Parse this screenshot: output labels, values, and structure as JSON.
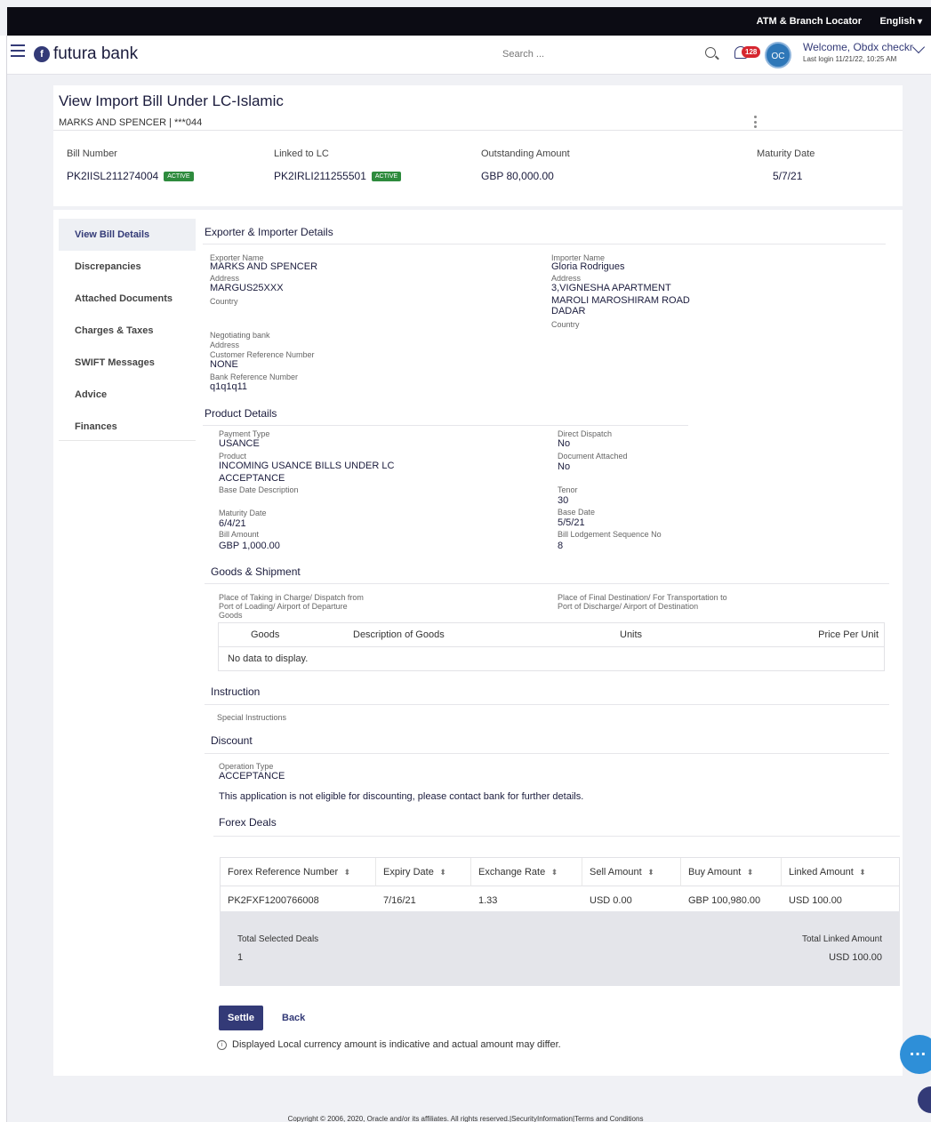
{
  "topbar": {
    "atm_locator": "ATM & Branch Locator",
    "language": "English"
  },
  "header": {
    "brand": "futura bank",
    "search_placeholder": "Search ...",
    "notifications_count": "128",
    "avatar_initials": "OC",
    "welcome": "Welcome, Obdx checkr",
    "last_login": "Last login 11/21/22, 10:25 AM"
  },
  "page": {
    "title": "View Import Bill Under LC-Islamic",
    "subtitle": "MARKS AND SPENCER | ***044"
  },
  "summary": {
    "bill_number_label": "Bill Number",
    "bill_number": "PK2IISL211274004",
    "bill_status": "ACTIVE",
    "linked_lc_label": "Linked to LC",
    "linked_lc": "PK2IRLI211255501",
    "lc_status": "ACTIVE",
    "outstanding_label": "Outstanding Amount",
    "outstanding": "GBP 80,000.00",
    "maturity_label": "Maturity Date",
    "maturity": "5/7/21"
  },
  "nav": [
    "View Bill Details",
    "Discrepancies",
    "Attached Documents",
    "Charges & Taxes",
    "SWIFT Messages",
    "Advice",
    "Finances"
  ],
  "exporter_importer": {
    "title": "Exporter & Importer Details",
    "exporter_name_label": "Exporter Name",
    "exporter_name": "MARKS AND SPENCER",
    "address_label": "Address",
    "exporter_address": "MARGUS25XXX",
    "country_label": "Country",
    "importer_name_label": "Importer Name",
    "importer_name": "Gloria Rodrigues",
    "importer_address_1": "3,VIGNESHA APARTMENT",
    "importer_address_2": "MAROLI MAROSHIRAM ROAD",
    "importer_address_3": "DADAR",
    "negotiating_bank_label": "Negotiating bank",
    "customer_ref_label": "Customer Reference Number",
    "customer_ref": "NONE",
    "bank_ref_label": "Bank Reference Number",
    "bank_ref": "q1q1q11"
  },
  "product": {
    "title": "Product Details",
    "payment_type_label": "Payment Type",
    "payment_type": "USANCE",
    "product_label": "Product",
    "product_1": "INCOMING USANCE BILLS UNDER LC",
    "product_2": "ACCEPTANCE",
    "base_date_desc_label": "Base Date Description",
    "maturity_label": "Maturity Date",
    "maturity": "6/4/21",
    "bill_amount_label": "Bill Amount",
    "bill_amount": "GBP 1,000.00",
    "direct_dispatch_label": "Direct Dispatch",
    "direct_dispatch": "No",
    "doc_attached_label": "Document Attached",
    "doc_attached": "No",
    "tenor_label": "Tenor",
    "tenor": "30",
    "base_date_label": "Base Date",
    "base_date": "5/5/21",
    "lodgement_label": "Bill Lodgement Sequence No",
    "lodgement": "8"
  },
  "goods": {
    "title": "Goods & Shipment",
    "place_taking_label": "Place of Taking in Charge/ Dispatch from",
    "port_loading_label": "Port of Loading/ Airport of Departure",
    "goods_label": "Goods",
    "place_final_label": "Place of Final Destination/ For Transportation to",
    "port_discharge_label": "Port of Discharge/ Airport of Destination",
    "columns": [
      "Goods",
      "Description of Goods",
      "Units",
      "Price Per Unit"
    ],
    "empty": "No data to display."
  },
  "instruction": {
    "title": "Instruction",
    "special_label": "Special Instructions"
  },
  "discount": {
    "title": "Discount",
    "operation_type_label": "Operation Type",
    "operation_type": "ACCEPTANCE",
    "message": "This application is not eligible for discounting, please contact bank for further details."
  },
  "forex": {
    "title": "Forex Deals",
    "columns": [
      "Forex Reference Number",
      "Expiry Date",
      "Exchange Rate",
      "Sell Amount",
      "Buy Amount",
      "Linked Amount"
    ],
    "row": [
      "PK2FXF1200766008",
      "7/16/21",
      "1.33",
      "USD 0.00",
      "GBP 100,980.00",
      "USD 100.00"
    ],
    "total_deals_label": "Total Selected Deals",
    "total_deals": "1",
    "total_linked_label": "Total Linked Amount",
    "total_linked": "USD 100.00"
  },
  "actions": {
    "settle": "Settle",
    "back": "Back"
  },
  "note": "Displayed Local currency amount is indicative and actual amount may differ.",
  "footer": "Copyright © 2006, 2020, Oracle and/or its affiliates. All rights reserved.|SecurityInformation|Terms and Conditions"
}
